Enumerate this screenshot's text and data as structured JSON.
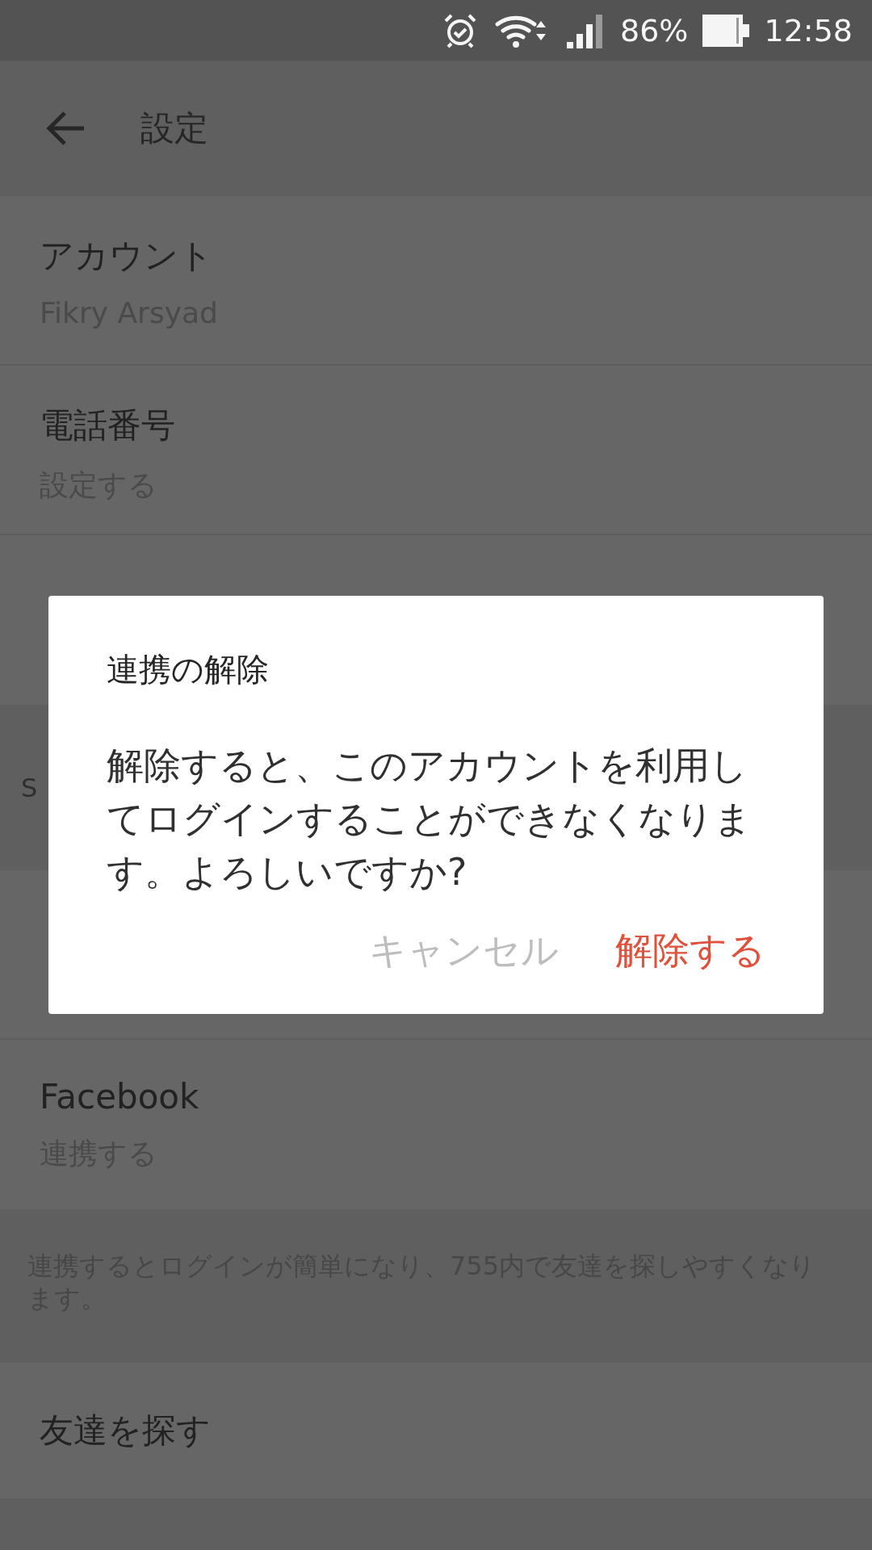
{
  "status_bar": {
    "battery": "86%",
    "time": "12:58"
  },
  "header": {
    "title": "設定"
  },
  "account_items": [
    {
      "title": "アカウント",
      "subtitle": "Fikry Arsyad"
    },
    {
      "title": "電話番号",
      "subtitle": "設定する"
    }
  ],
  "section_header": "S",
  "link_items": [
    {
      "title": "Facebook",
      "subtitle": "連携する"
    }
  ],
  "note": "連携するとログインが簡単になり、755内で友達を探しやすくなります。",
  "friends_item": {
    "title": "友達を探す"
  },
  "dialog": {
    "title": "連携の解除",
    "message": "解除すると、このアカウントを利用してログインすることができなくなります。よろしいですか?",
    "buttons": [
      {
        "label": "キャンセル",
        "kind": "cancel"
      },
      {
        "label": "解除する",
        "kind": "confirm"
      }
    ]
  }
}
